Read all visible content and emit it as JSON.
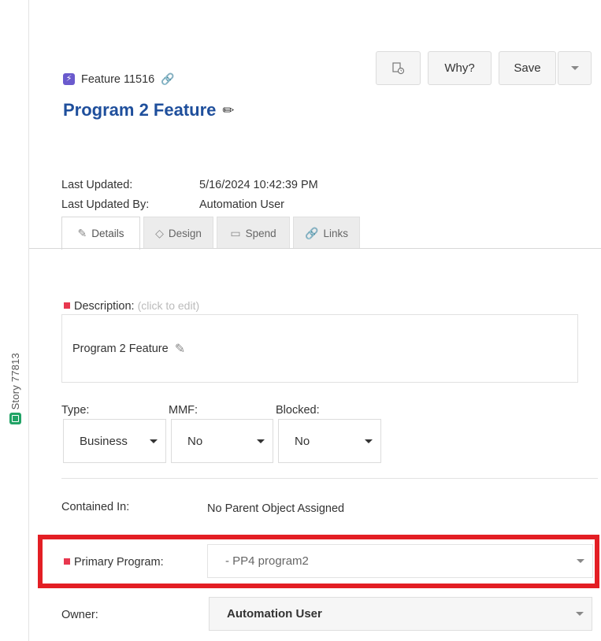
{
  "side_tab": {
    "label": "Story 77813"
  },
  "header": {
    "feature_id": "Feature 11516",
    "title": "Program 2 Feature",
    "buttons": {
      "why": "Why?",
      "save": "Save"
    }
  },
  "meta": {
    "last_updated_label": "Last Updated:",
    "last_updated_value": "5/16/2024 10:42:39 PM",
    "last_updated_by_label": "Last Updated By:",
    "last_updated_by_value": "Automation User"
  },
  "tabs": [
    {
      "label": "Details",
      "icon": "pencil-icon",
      "active": true
    },
    {
      "label": "Design",
      "icon": "diamond-icon",
      "active": false
    },
    {
      "label": "Spend",
      "icon": "money-icon",
      "active": false
    },
    {
      "label": "Links",
      "icon": "link-icon",
      "active": false
    }
  ],
  "description": {
    "label": "Description:",
    "hint": "(click to edit)",
    "value": "Program 2 Feature"
  },
  "fields": {
    "type": {
      "label": "Type:",
      "value": "Business"
    },
    "mmf": {
      "label": "MMF:",
      "value": "No"
    },
    "blocked": {
      "label": "Blocked:",
      "value": "No"
    },
    "contained_in": {
      "label": "Contained In:",
      "value": "No Parent Object Assigned"
    },
    "primary_program": {
      "label": "Primary Program:",
      "value": "- PP4 program2"
    },
    "owner": {
      "label": "Owner:",
      "value": "Automation User"
    }
  },
  "colors": {
    "title": "#1f4f9c",
    "required_marker": "#e8384f",
    "highlight_border": "#e31e24",
    "story_icon": "#21a366",
    "feature_icon": "#6a5acd"
  }
}
